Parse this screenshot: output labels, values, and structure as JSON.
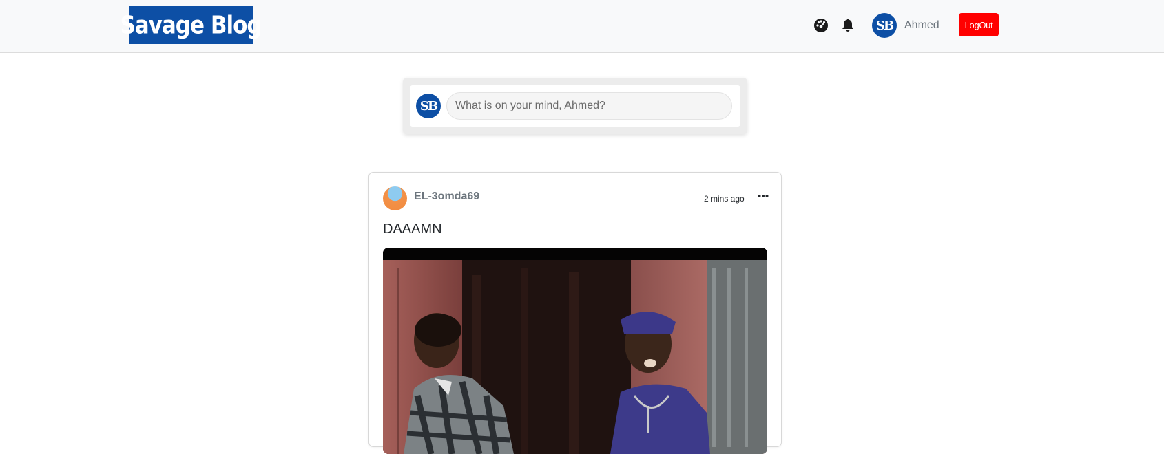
{
  "brand": {
    "logo_text": "Savage Blog",
    "primary_color": "#0d4fa5"
  },
  "navbar": {
    "icons": [
      "dashboard-icon",
      "bell-icon"
    ],
    "avatar_text": "SB",
    "username": "Ahmed",
    "logout_label": "LogOut",
    "logout_color": "#ff0000"
  },
  "composer": {
    "avatar_text": "SB",
    "placeholder": "What is on your mind, Ahmed?"
  },
  "post": {
    "author": "EL-3omda69",
    "time": "2 mins ago",
    "menu_icon": "more-horizontal-icon",
    "title": "DAAAMN",
    "media_type": "animated-gif"
  }
}
